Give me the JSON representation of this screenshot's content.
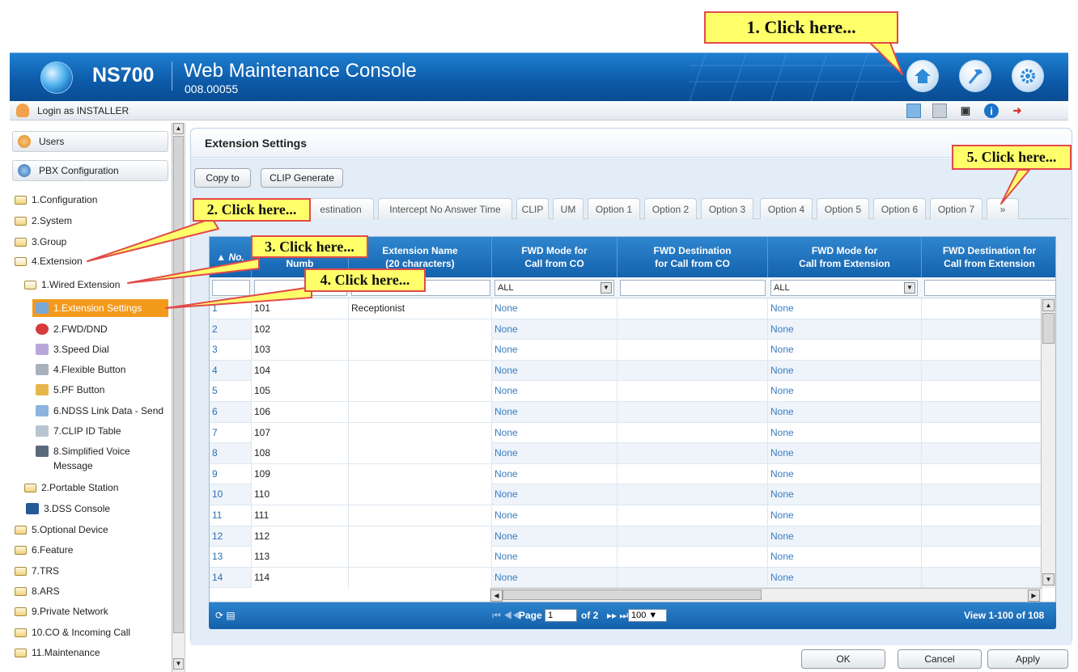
{
  "header": {
    "brand": "NS700",
    "title": "Web Maintenance Console",
    "version": "008.00055"
  },
  "login": {
    "text": "Login as INSTALLER"
  },
  "sidebar": {
    "users_label": "Users",
    "pbx_label": "PBX Configuration",
    "items": [
      "1.Configuration",
      "2.System",
      "3.Group",
      "4.Extension",
      "1.Wired Extension",
      "1.Extension Settings",
      "2.FWD/DND",
      "3.Speed Dial",
      "4.Flexible Button",
      "5.PF Button",
      "6.NDSS Link Data - Send",
      "7.CLIP ID Table",
      "8.Simplified Voice",
      "Message",
      "2.Portable Station",
      "3.DSS Console",
      "5.Optional Device",
      "6.Feature",
      "7.TRS",
      "8.ARS",
      "9.Private Network",
      "10.CO & Incoming Call",
      "11.Maintenance"
    ]
  },
  "page": {
    "title": "Extension Settings",
    "copy_to": "Copy to",
    "clip_generate": "CLIP Generate"
  },
  "tabs": [
    "estination",
    "Intercept No Answer Time",
    "CLIP",
    "UM",
    "Option 1",
    "Option 2",
    "Option 3",
    "Option 4",
    "Option 5",
    "Option 6",
    "Option 7",
    "»"
  ],
  "grid": {
    "headers": {
      "no": "No.",
      "number": "Numb",
      "ext_name_1": "Extension Name",
      "ext_name_2": "(20 characters)",
      "fwd_co_1": "FWD Mode for",
      "fwd_co_2": "Call from CO",
      "dest_co_1": "FWD Destination",
      "dest_co_2": "for Call from CO",
      "fwd_ext_1": "FWD Mode for",
      "fwd_ext_2": "Call from Extension",
      "dest_ext_1": "FWD Destination for",
      "dest_ext_2": "Call from Extension"
    },
    "filter_all": "ALL",
    "rows": [
      {
        "no": "1",
        "number": "101",
        "name": "Receptionist",
        "fwd_co": "None",
        "fwd_ext": "None"
      },
      {
        "no": "2",
        "number": "102",
        "name": "",
        "fwd_co": "None",
        "fwd_ext": "None"
      },
      {
        "no": "3",
        "number": "103",
        "name": "",
        "fwd_co": "None",
        "fwd_ext": "None"
      },
      {
        "no": "4",
        "number": "104",
        "name": "",
        "fwd_co": "None",
        "fwd_ext": "None"
      },
      {
        "no": "5",
        "number": "105",
        "name": "",
        "fwd_co": "None",
        "fwd_ext": "None"
      },
      {
        "no": "6",
        "number": "106",
        "name": "",
        "fwd_co": "None",
        "fwd_ext": "None"
      },
      {
        "no": "7",
        "number": "107",
        "name": "",
        "fwd_co": "None",
        "fwd_ext": "None"
      },
      {
        "no": "8",
        "number": "108",
        "name": "",
        "fwd_co": "None",
        "fwd_ext": "None"
      },
      {
        "no": "9",
        "number": "109",
        "name": "",
        "fwd_co": "None",
        "fwd_ext": "None"
      },
      {
        "no": "10",
        "number": "110",
        "name": "",
        "fwd_co": "None",
        "fwd_ext": "None"
      },
      {
        "no": "11",
        "number": "111",
        "name": "",
        "fwd_co": "None",
        "fwd_ext": "None"
      },
      {
        "no": "12",
        "number": "112",
        "name": "",
        "fwd_co": "None",
        "fwd_ext": "None"
      },
      {
        "no": "13",
        "number": "113",
        "name": "",
        "fwd_co": "None",
        "fwd_ext": "None"
      },
      {
        "no": "14",
        "number": "114",
        "name": "",
        "fwd_co": "None",
        "fwd_ext": "None"
      }
    ]
  },
  "pager": {
    "page_label": "Page",
    "page_value": "1",
    "of_label": "of 2",
    "page_size": "100",
    "view": "View 1-100 of 108"
  },
  "bottom": {
    "ok": "OK",
    "cancel": "Cancel",
    "apply": "Apply"
  },
  "callouts": {
    "c1": "1. Click here...",
    "c2": "2. Click here...",
    "c3": "3. Click here...",
    "c4": "4. Click here...",
    "c5": "5. Click here..."
  },
  "colors": {
    "accent": "#1466b2",
    "highlight": "#f39a1d",
    "callout_bg": "#ffff6a",
    "callout_border": "#e14a4a"
  }
}
